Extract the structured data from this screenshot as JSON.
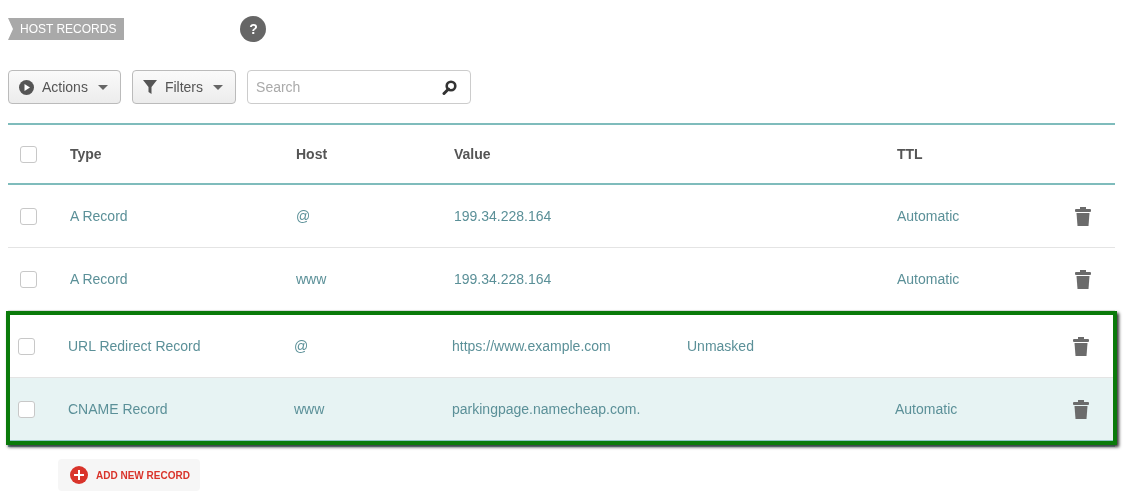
{
  "section_tag": "HOST RECORDS",
  "help": "?",
  "toolbar": {
    "actions": "Actions",
    "filters": "Filters",
    "search": {
      "placeholder": "Search"
    }
  },
  "table": {
    "select_all": {
      "checked": false
    },
    "columns": [
      "Type",
      "Host",
      "Value",
      "TTL"
    ],
    "rows": [
      {
        "type": "A Record",
        "host": "@",
        "value": "199.34.228.164",
        "ttl": "Automatic",
        "checked": false,
        "shaded": false,
        "in_callout": false
      },
      {
        "type": "A Record",
        "host": "www",
        "value": "199.34.228.164",
        "ttl": "Automatic",
        "checked": false,
        "shaded": false,
        "in_callout": false
      },
      {
        "type": "URL Redirect Record",
        "host": "@",
        "value": "https://www.example.com",
        "column_4": "Unmasked",
        "checked": false,
        "shaded": false,
        "in_callout": true
      },
      {
        "type": "CNAME Record",
        "host": "www",
        "value": "parkingpage.namecheap.com.",
        "ttl": "Automatic",
        "checked": false,
        "shaded": true,
        "in_callout": true
      }
    ]
  },
  "add_button": "ADD NEW RECORD"
}
